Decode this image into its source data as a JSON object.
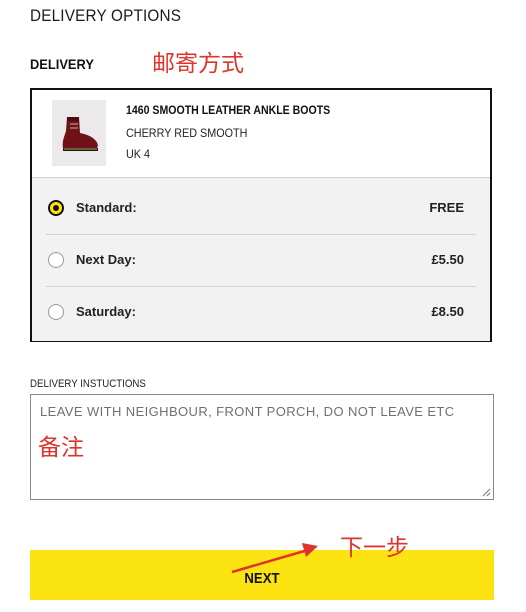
{
  "header": {
    "title": "DELIVERY OPTIONS"
  },
  "delivery": {
    "section_title": "DELIVERY"
  },
  "product": {
    "name": "1460 SMOOTH LEATHER ANKLE BOOTS",
    "color": "CHERRY RED SMOOTH",
    "size": "UK 4",
    "image_icon": "boot-image"
  },
  "options": [
    {
      "label": "Standard:",
      "price": "FREE",
      "selected": true
    },
    {
      "label": "Next Day:",
      "price": "£5.50",
      "selected": false
    },
    {
      "label": "Saturday:",
      "price": "£8.50",
      "selected": false
    }
  ],
  "instructions": {
    "label": "DELIVERY INSTUCTIONS",
    "placeholder": "LEAVE WITH NEIGHBOUR, FRONT PORCH, DO NOT LEAVE ETC"
  },
  "next_button": {
    "label": "NEXT"
  },
  "annotations": {
    "shipping_method": "邮寄方式",
    "notes": "备注",
    "next_step": "下一步"
  },
  "colors": {
    "accent_yellow": "#fce312",
    "annotation_red": "#e0332a",
    "border_dark": "#111111"
  }
}
